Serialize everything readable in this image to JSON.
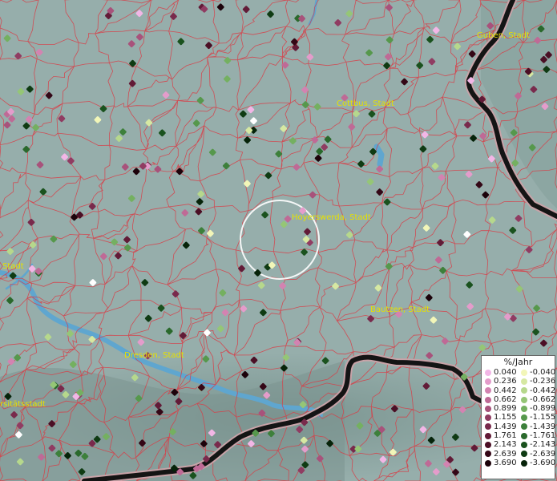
{
  "map": {
    "cities": [
      {
        "name": "Guben, Stadt"
      },
      {
        "name": "Cottbus, Stadt"
      },
      {
        "name": "Hoyerswerda, Stadt"
      },
      {
        "name": "Bautzen, Stadt"
      },
      {
        "name": "Dresden, Stadt"
      },
      {
        "name": "Stadt"
      },
      {
        "name": "rsitätsstadt"
      }
    ]
  },
  "legend": {
    "title": "%/Jahr",
    "positive": [
      {
        "label": "0.040",
        "color": "#f2b6e6"
      },
      {
        "label": "0.236",
        "color": "#e49ccb"
      },
      {
        "label": "0.442",
        "color": "#d383b1"
      },
      {
        "label": "0.662",
        "color": "#bf6a96"
      },
      {
        "label": "0.899",
        "color": "#a8527b"
      },
      {
        "label": "1.155",
        "color": "#903c62"
      },
      {
        "label": "1.439",
        "color": "#792a4c"
      },
      {
        "label": "1.761",
        "color": "#621b37"
      },
      {
        "label": "2.143",
        "color": "#4b0f25"
      },
      {
        "label": "2.639",
        "color": "#340716"
      },
      {
        "label": "3.690",
        "color": "#1c020a"
      }
    ],
    "negative": [
      {
        "label": "-0.040",
        "color": "#f2f6b8"
      },
      {
        "label": "-0.236",
        "color": "#d6e8a2"
      },
      {
        "label": "-0.442",
        "color": "#b6d88c"
      },
      {
        "label": "-0.662",
        "color": "#95c676"
      },
      {
        "label": "-0.899",
        "color": "#74b060"
      },
      {
        "label": "-1.155",
        "color": "#56984c"
      },
      {
        "label": "-1.439",
        "color": "#3d803b"
      },
      {
        "label": "-1.761",
        "color": "#2a692c"
      },
      {
        "label": "-2.143",
        "color": "#1a521e"
      },
      {
        "label": "-2.639",
        "color": "#0f3b13"
      },
      {
        "label": "-3.690",
        "color": "#062309"
      }
    ]
  }
}
